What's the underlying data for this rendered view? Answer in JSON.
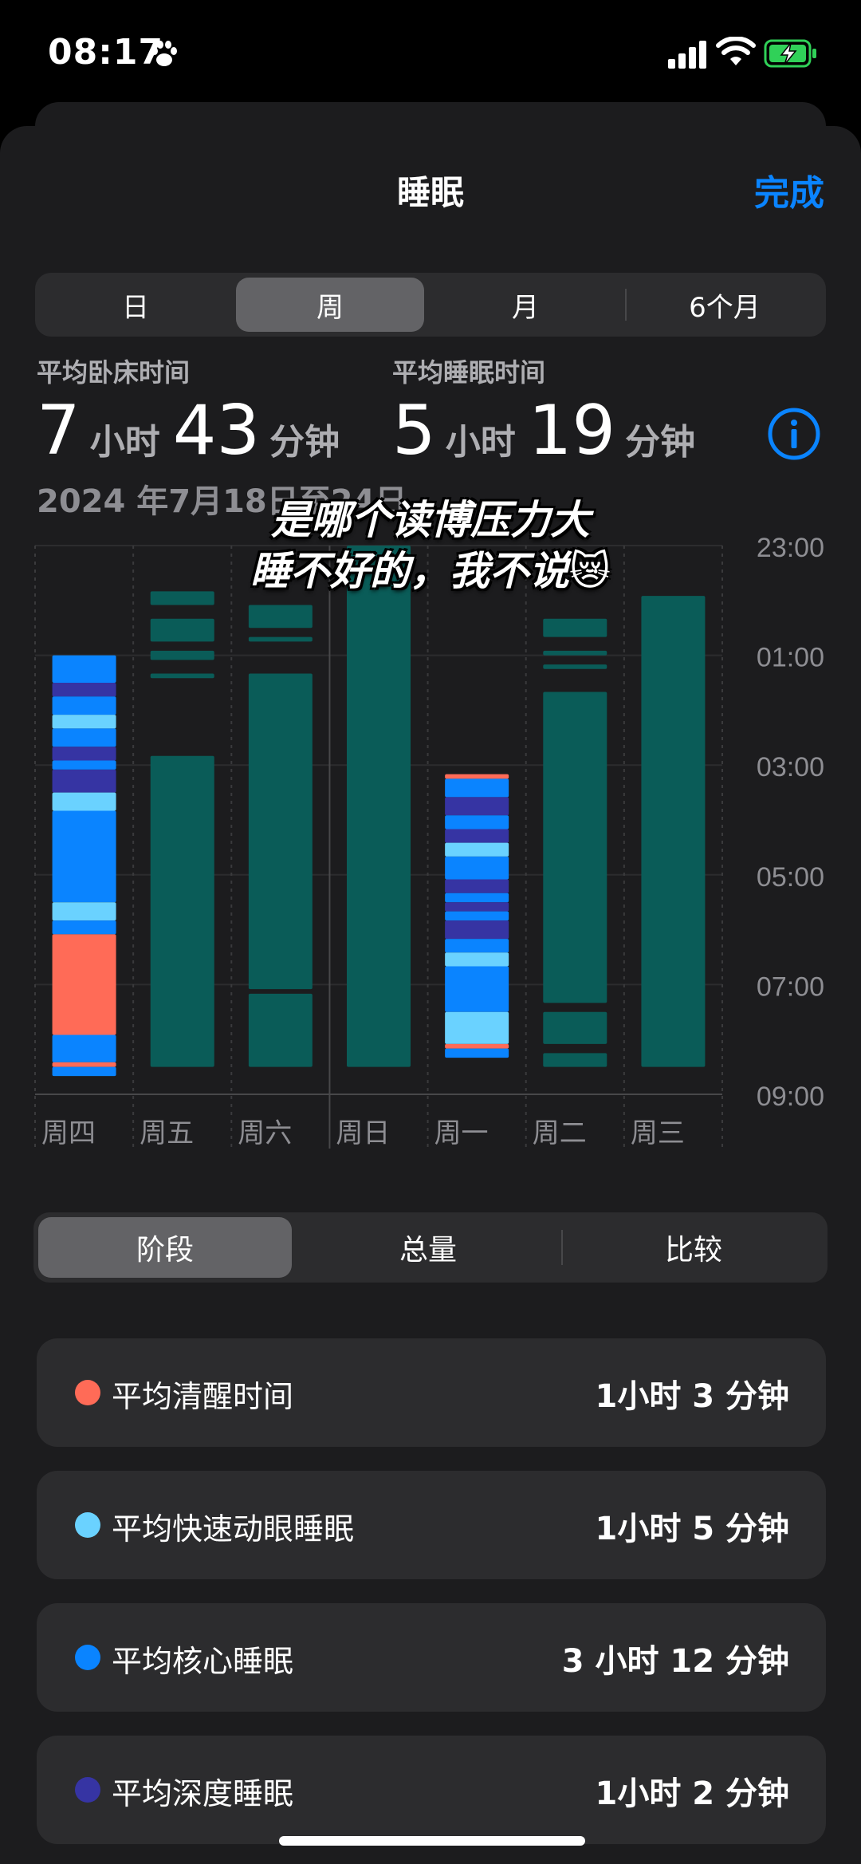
{
  "status_bar": {
    "time": "08:17",
    "icons": [
      "paw-icon",
      "signal-icon",
      "wifi-icon",
      "battery-charging-icon"
    ],
    "battery_color": "#30d158"
  },
  "header": {
    "title": "睡眠",
    "done_label": "完成"
  },
  "period_tabs": {
    "items": [
      "日",
      "周",
      "月",
      "6个月"
    ],
    "selected": "周"
  },
  "stats": {
    "in_bed": {
      "label": "平均卧床时间",
      "hours": "7",
      "hour_unit": "小时",
      "minutes": "43",
      "minute_unit": "分钟"
    },
    "asleep": {
      "label": "平均睡眠时间",
      "hours": "5",
      "hour_unit": "小时",
      "minutes": "19",
      "minute_unit": "分钟"
    },
    "date_range": "2024 年7月18日至24日"
  },
  "overlay": {
    "line1": "是哪个读博压力大",
    "line2": "睡不好的，我不说😿"
  },
  "colors": {
    "awake": "#ff6b57",
    "rem": "#6ad2ff",
    "core": "#0a84ff",
    "deep": "#3634a3",
    "in_bed": "#0a5c58",
    "accent": "#0a84ff"
  },
  "chart_data": {
    "type": "bar",
    "y_ticks": [
      "23:00",
      "01:00",
      "03:00",
      "05:00",
      "07:00",
      "09:00"
    ],
    "x_labels": [
      "周四",
      "周五",
      "周六",
      "周日",
      "周一",
      "周二",
      "周三"
    ],
    "series_kind": "sleep stages (stacked segments, time of night)",
    "days": [
      {
        "day": "周四",
        "type": "stages",
        "segments": [
          [
            "01:00",
            "01:30",
            "core"
          ],
          [
            "01:30",
            "01:45",
            "deep"
          ],
          [
            "01:45",
            "02:05",
            "core"
          ],
          [
            "02:05",
            "02:20",
            "rem"
          ],
          [
            "02:20",
            "02:40",
            "core"
          ],
          [
            "02:40",
            "02:55",
            "deep"
          ],
          [
            "02:55",
            "03:05",
            "core"
          ],
          [
            "03:05",
            "03:30",
            "deep"
          ],
          [
            "03:30",
            "03:50",
            "rem"
          ],
          [
            "03:50",
            "05:30",
            "core"
          ],
          [
            "05:30",
            "05:50",
            "rem"
          ],
          [
            "05:50",
            "06:05",
            "core"
          ],
          [
            "06:05",
            "07:55",
            "awake"
          ],
          [
            "07:55",
            "08:25",
            "core"
          ],
          [
            "08:25",
            "08:30",
            "awake"
          ],
          [
            "08:30",
            "08:40",
            "core"
          ]
        ]
      },
      {
        "day": "周五",
        "type": "in_bed",
        "segments": [
          [
            "23:50",
            "00:05"
          ],
          [
            "00:20",
            "00:45"
          ],
          [
            "00:55",
            "01:05"
          ],
          [
            "01:20",
            "01:25"
          ],
          [
            "02:50",
            "08:30"
          ]
        ]
      },
      {
        "day": "周六",
        "type": "in_bed",
        "segments": [
          [
            "00:05",
            "00:30"
          ],
          [
            "00:40",
            "00:45"
          ],
          [
            "01:20",
            "07:05"
          ],
          [
            "07:10",
            "08:30"
          ]
        ]
      },
      {
        "day": "周日",
        "type": "in_bed",
        "segments": [
          [
            "23:00",
            "08:30"
          ]
        ]
      },
      {
        "day": "周一",
        "type": "stages",
        "segments": [
          [
            "03:10",
            "03:15",
            "awake"
          ],
          [
            "03:15",
            "03:35",
            "core"
          ],
          [
            "03:35",
            "03:55",
            "deep"
          ],
          [
            "03:55",
            "04:10",
            "core"
          ],
          [
            "04:10",
            "04:25",
            "deep"
          ],
          [
            "04:25",
            "04:40",
            "rem"
          ],
          [
            "04:40",
            "05:05",
            "core"
          ],
          [
            "05:05",
            "05:20",
            "deep"
          ],
          [
            "05:20",
            "05:30",
            "core"
          ],
          [
            "05:30",
            "05:40",
            "deep"
          ],
          [
            "05:40",
            "05:50",
            "core"
          ],
          [
            "05:50",
            "06:10",
            "deep"
          ],
          [
            "06:10",
            "06:25",
            "core"
          ],
          [
            "06:25",
            "06:40",
            "rem"
          ],
          [
            "06:40",
            "07:30",
            "core"
          ],
          [
            "07:30",
            "08:05",
            "rem"
          ],
          [
            "08:05",
            "08:10",
            "awake"
          ],
          [
            "08:10",
            "08:20",
            "core"
          ]
        ]
      },
      {
        "day": "周二",
        "type": "in_bed",
        "segments": [
          [
            "00:20",
            "00:40"
          ],
          [
            "00:55",
            "01:00"
          ],
          [
            "01:10",
            "01:15"
          ],
          [
            "01:40",
            "07:20"
          ],
          [
            "07:30",
            "08:05"
          ],
          [
            "08:15",
            "08:30"
          ]
        ]
      },
      {
        "day": "周三",
        "type": "in_bed",
        "segments": [
          [
            "23:55",
            "08:30"
          ]
        ]
      }
    ]
  },
  "view_tabs": {
    "items": [
      "阶段",
      "总量",
      "比较"
    ],
    "selected": "阶段"
  },
  "stage_cards": [
    {
      "label": "平均清醒时间",
      "value": "1小时 3 分钟",
      "color": "#ff6b57"
    },
    {
      "label": "平均快速动眼睡眠",
      "value": "1小时 5 分钟",
      "color": "#6ad2ff"
    },
    {
      "label": "平均核心睡眠",
      "value": "3 小时 12 分钟",
      "color": "#0a84ff"
    },
    {
      "label": "平均深度睡眠",
      "value": "1小时 2 分钟",
      "color": "#3634a3"
    }
  ]
}
